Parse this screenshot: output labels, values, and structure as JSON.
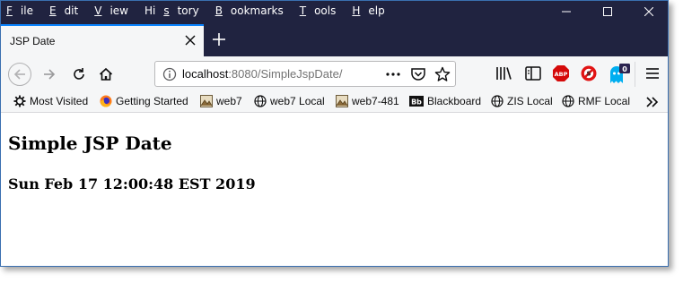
{
  "menu": {
    "items": [
      {
        "u": "F",
        "rest": "ile"
      },
      {
        "u": "E",
        "rest": "dit"
      },
      {
        "u": "V",
        "rest": "iew"
      },
      {
        "pre": "Hi",
        "u": "s",
        "rest": "tory"
      },
      {
        "u": "B",
        "rest": "ookmarks"
      },
      {
        "u": "T",
        "rest": "ools"
      },
      {
        "u": "H",
        "rest": "elp"
      }
    ]
  },
  "tab": {
    "title": "JSP Date"
  },
  "urlbar": {
    "host": "localhost",
    "path": ":8080/SimpleJspDate/"
  },
  "toolbar": {
    "badge_count": "0",
    "abp_label": "ABP"
  },
  "bookmarks": {
    "items": [
      {
        "label": "Most Visited",
        "icon": "gear-icon"
      },
      {
        "label": "Getting Started",
        "icon": "firefox-icon"
      },
      {
        "label": "web7",
        "icon": "image-icon"
      },
      {
        "label": "web7 Local",
        "icon": "globe-icon"
      },
      {
        "label": "web7-481",
        "icon": "image-icon"
      },
      {
        "label": "Blackboard",
        "icon": "blackboard-icon",
        "icon_text": "Bb"
      },
      {
        "label": "ZIS Local",
        "icon": "globe-icon"
      },
      {
        "label": "RMF Local",
        "icon": "globe-icon"
      }
    ]
  },
  "page": {
    "heading": "Simple JSP Date",
    "date": "Sun Feb 17 12:00:48 EST 2019"
  },
  "colors": {
    "titlebar": "#202340",
    "accent": "#0a84ff"
  }
}
